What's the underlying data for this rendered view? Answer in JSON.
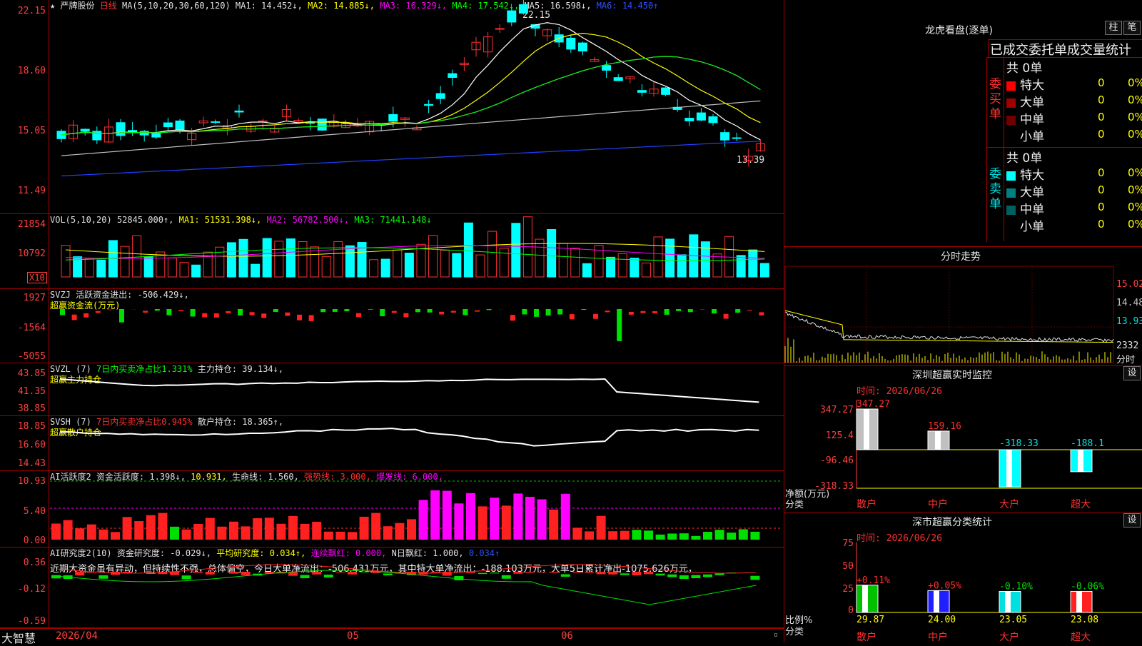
{
  "main_header": {
    "star": "★",
    "stock_name": "严牌股份",
    "period": "日线",
    "ma_params": "MA(5,10,20,30,60,120)",
    "ma1": "MA1: 14.452↓,",
    "ma2": "MA2: 14.885↓,",
    "ma3": "MA3: 16.329↓,",
    "ma4": "MA4: 17.542↓,",
    "ma5": "MA5: 16.598↓,",
    "ma6": "MA6: 14.450↑"
  },
  "price_axis": [
    "22.15",
    "18.60",
    "15.05",
    "11.49"
  ],
  "price_high_label": "22.15",
  "price_low_label": "13.39",
  "vol_header": {
    "params": "VOL(5,10,20)",
    "vol": "52845.000↑,",
    "ma1": "MA1: 51531.398↓,",
    "ma2": "MA2: 56782.500↓,",
    "ma3": "MA3: 71441.148↓"
  },
  "vol_axis": [
    "21854",
    "10792"
  ],
  "vol_unit": "X10",
  "svzj": {
    "params": "SVZJ",
    "label": "活跃资金进出: -506.429↓,",
    "sub": "超赢资金流(万元)",
    "axis": [
      "1927",
      "-1564",
      "-5055"
    ]
  },
  "svzl": {
    "params": "SVZL (7)",
    "green_text": "7日内买卖净占比1.331%",
    "label": "主力持仓: 39.134↓,",
    "sub": "超赢主力持仓",
    "axis": [
      "43.85",
      "41.35",
      "38.85"
    ]
  },
  "svsh": {
    "params": "SVSH (7)",
    "red_text": "7日内买卖净占比0.945%",
    "label": "散户持仓: 18.365↑,",
    "sub": "超赢散户持仓",
    "axis": [
      "18.85",
      "16.60",
      "14.43"
    ]
  },
  "ai_active": {
    "params": "AI活跃度2",
    "label": "资金活跃度: 1.398↓,",
    "v2": "10.931,",
    "life": "生命线: 1.560,",
    "strong": "强势线: 3.000,",
    "burst": "爆发线: 6.000,",
    "axis": [
      "10.93",
      "5.40",
      "0.00"
    ]
  },
  "ai_research": {
    "params": "AI研究度2(10)",
    "label": "资金研究度: -0.029↓,",
    "avg": "平均研究度: 0.034↑,",
    "lianxu": "连续飘红: 0.000,",
    "nday": "N日飘红: 1.000,",
    "last": "0.034↑",
    "comment": "近期大资金虽有异动，但持续性不强，总体偏空，今日大单净流出：-506.431万元，其中特大单净流出：-188.103万元，大单5日累计净出-1075.626万元，",
    "axis": [
      "0.36",
      "-0.12",
      "-0.59"
    ]
  },
  "bottom_bar": {
    "brand": "大智慧",
    "date": "2026/04",
    "m05": "05",
    "m06": "06"
  },
  "longhu": {
    "title": "龙虎看盘(逐单)",
    "btn1": "柱",
    "btn2": "笔",
    "subtitle": "已成交委托单成交量统计",
    "buy_label": "委买单",
    "sell_label": "委卖单",
    "buy_total": "共 0单",
    "sell_total": "共 0单",
    "buy_rows": [
      {
        "name": "特大",
        "count": "0",
        "pct": "0%",
        "color": "#ff0000"
      },
      {
        "name": "大单",
        "count": "0",
        "pct": "0%",
        "color": "#a00000"
      },
      {
        "name": "中单",
        "count": "0",
        "pct": "0%",
        "color": "#700000"
      },
      {
        "name": "小单",
        "count": "0",
        "pct": "0%",
        "color": "#000000"
      }
    ],
    "sell_rows": [
      {
        "name": "特大",
        "count": "0",
        "pct": "0%",
        "color": "#00ffff"
      },
      {
        "name": "大单",
        "count": "0",
        "pct": "0%",
        "color": "#008080"
      },
      {
        "name": "中单",
        "count": "0",
        "pct": "0%",
        "color": "#006060"
      },
      {
        "name": "小单",
        "count": "0",
        "pct": "0%",
        "color": "#000000"
      }
    ]
  },
  "fenshi": {
    "title": "分时走势",
    "axis": [
      "15.02",
      "14.48",
      "13.93"
    ],
    "vol_label": "2332",
    "time_label": "分时"
  },
  "sz_monitor": {
    "title": "深圳超赢实时监控",
    "set": "设",
    "time": "时间: 2026/06/26",
    "axis": [
      "347.27",
      "125.4",
      "-96.46",
      "-318.33"
    ],
    "unit": "净额(万元)",
    "cat_label": "分类",
    "bars": [
      {
        "name": "散户",
        "value": 347.27,
        "label": "347.27",
        "name_color": "#ff3030"
      },
      {
        "name": "中户",
        "value": 159.16,
        "label": "159.16",
        "name_color": "#ff3030"
      },
      {
        "name": "大户",
        "value": -318.33,
        "label": "-318.33",
        "name_color": "#ff3030"
      },
      {
        "name": "超大",
        "value": -188.1,
        "label": "-188.1",
        "name_color": "#ff3030"
      }
    ]
  },
  "sz_class": {
    "title": "深市超赢分类统计",
    "set": "设",
    "time": "时间: 2026/06/26",
    "axis": [
      "75",
      "50",
      "25",
      "0"
    ],
    "unit": "比例%",
    "cat_label": "分类",
    "bars": [
      {
        "name": "散户",
        "value": 29.87,
        "label": "29.87",
        "change": "+0.11%",
        "color": "#00c000"
      },
      {
        "name": "中户",
        "value": 24.0,
        "label": "24.00",
        "change": "+0.05%",
        "color": "#2020ff"
      },
      {
        "name": "大户",
        "value": 23.05,
        "label": "23.05",
        "change": "-0.10%",
        "color": "#00e0e0"
      },
      {
        "name": "超大",
        "value": 23.08,
        "label": "23.08",
        "change": "-0.06%",
        "color": "#ff2020"
      }
    ]
  },
  "colors": {
    "up": "#ff3030",
    "down": "#00ffff",
    "border": "#a00000",
    "ma1": "#ffffff",
    "ma2": "#ffff00",
    "ma3": "#ff00ff",
    "ma4": "#00ff00",
    "ma5": "#c0c0c0",
    "ma6": "#2040ff"
  }
}
